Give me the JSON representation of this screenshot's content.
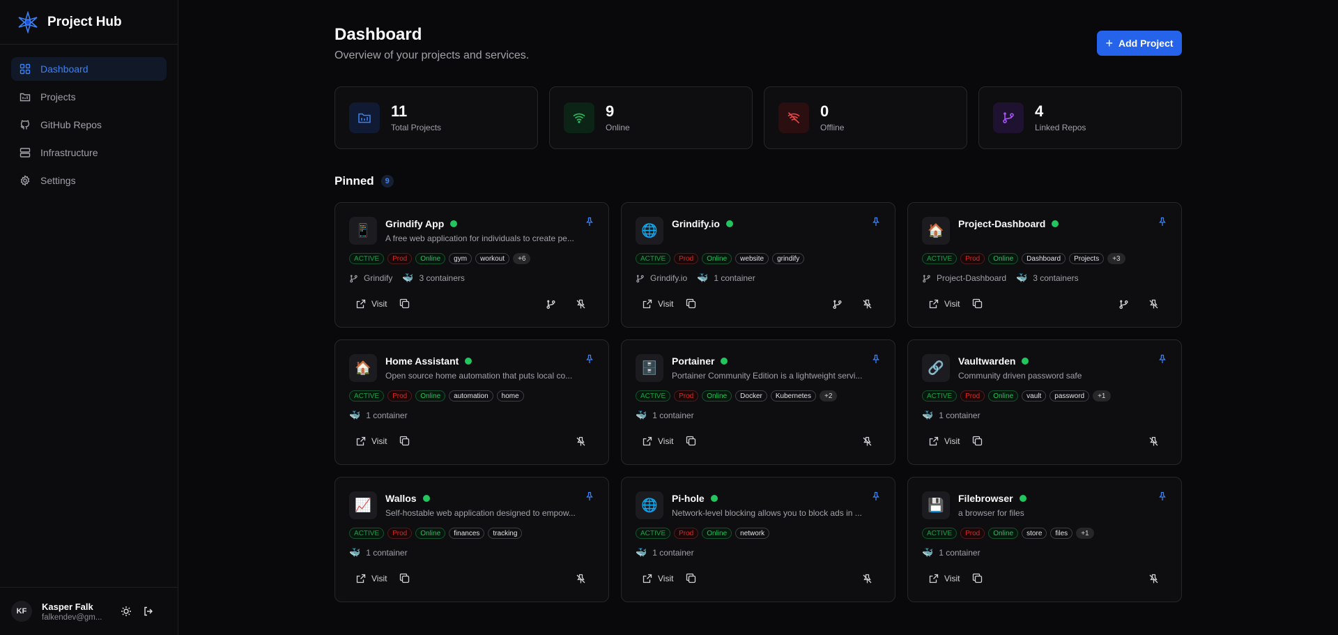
{
  "app": {
    "name": "Project Hub"
  },
  "nav": [
    {
      "label": "Dashboard",
      "icon": "grid-icon",
      "active": true
    },
    {
      "label": "Projects",
      "icon": "folder-icon",
      "active": false
    },
    {
      "label": "GitHub Repos",
      "icon": "github-icon",
      "active": false
    },
    {
      "label": "Infrastructure",
      "icon": "server-icon",
      "active": false
    },
    {
      "label": "Settings",
      "icon": "gear-icon",
      "active": false
    }
  ],
  "user": {
    "initials": "KF",
    "name": "Kasper Falk",
    "email": "falkendev@gm..."
  },
  "header": {
    "title": "Dashboard",
    "subtitle": "Overview of your projects and services.",
    "add_label": "Add Project"
  },
  "stats": [
    {
      "value": "11",
      "label": "Total Projects",
      "color": "#3b82f6",
      "icon": "folder-icon"
    },
    {
      "value": "9",
      "label": "Online",
      "color": "#22c55e",
      "icon": "wifi-icon"
    },
    {
      "value": "0",
      "label": "Offline",
      "color": "#ef4444",
      "icon": "wifi-off-icon"
    },
    {
      "value": "4",
      "label": "Linked Repos",
      "color": "#a855f7",
      "icon": "git-branch-icon"
    }
  ],
  "pinned": {
    "title": "Pinned",
    "count": "9",
    "projects": [
      {
        "name": "Grindify App",
        "emoji": "📱",
        "desc": "A free web application for individuals to create pe...",
        "tags": [
          "gym",
          "workout"
        ],
        "more": "+6",
        "repo": "Grindify",
        "containers": "3 containers",
        "git": true
      },
      {
        "name": "Grindify.io",
        "emoji": "🌐",
        "desc": "",
        "tags": [
          "website",
          "grindify"
        ],
        "more": "",
        "repo": "Grindify.io",
        "containers": "1 container",
        "git": true
      },
      {
        "name": "Project-Dashboard",
        "emoji": "🏠",
        "desc": "",
        "tags": [
          "Dashboard",
          "Projects"
        ],
        "more": "+3",
        "repo": "Project-Dashboard",
        "containers": "3 containers",
        "git": true
      },
      {
        "name": "Home Assistant",
        "emoji": "🏠",
        "desc": "Open source home automation that puts local co...",
        "tags": [
          "automation",
          "home"
        ],
        "more": "",
        "repo": "",
        "containers": "1 container",
        "git": false
      },
      {
        "name": "Portainer",
        "emoji": "🗄️",
        "desc": "Portainer Community Edition is a lightweight servi...",
        "tags": [
          "Docker",
          "Kubernetes"
        ],
        "more": "+2",
        "repo": "",
        "containers": "1 container",
        "git": false
      },
      {
        "name": "Vaultwarden",
        "emoji": "🔗",
        "desc": "Community driven password safe",
        "tags": [
          "vault",
          "password"
        ],
        "more": "+1",
        "repo": "",
        "containers": "1 container",
        "git": false
      },
      {
        "name": "Wallos",
        "emoji": "📈",
        "desc": "Self-hostable web application designed to empow...",
        "tags": [
          "finances",
          "tracking"
        ],
        "more": "",
        "repo": "",
        "containers": "1 container",
        "git": false
      },
      {
        "name": "Pi-hole",
        "emoji": "🌐",
        "desc": "Network-level blocking allows you to block ads in ...",
        "tags": [
          "network"
        ],
        "more": "",
        "repo": "",
        "containers": "1 container",
        "git": false
      },
      {
        "name": "Filebrowser",
        "emoji": "💾",
        "desc": "a browser for files",
        "tags": [
          "store",
          "files"
        ],
        "more": "+1",
        "repo": "",
        "containers": "1 container",
        "git": false
      }
    ]
  },
  "badges": {
    "status": "ACTIVE",
    "env": "Prod",
    "health": "Online"
  },
  "labels": {
    "visit": "Visit"
  }
}
